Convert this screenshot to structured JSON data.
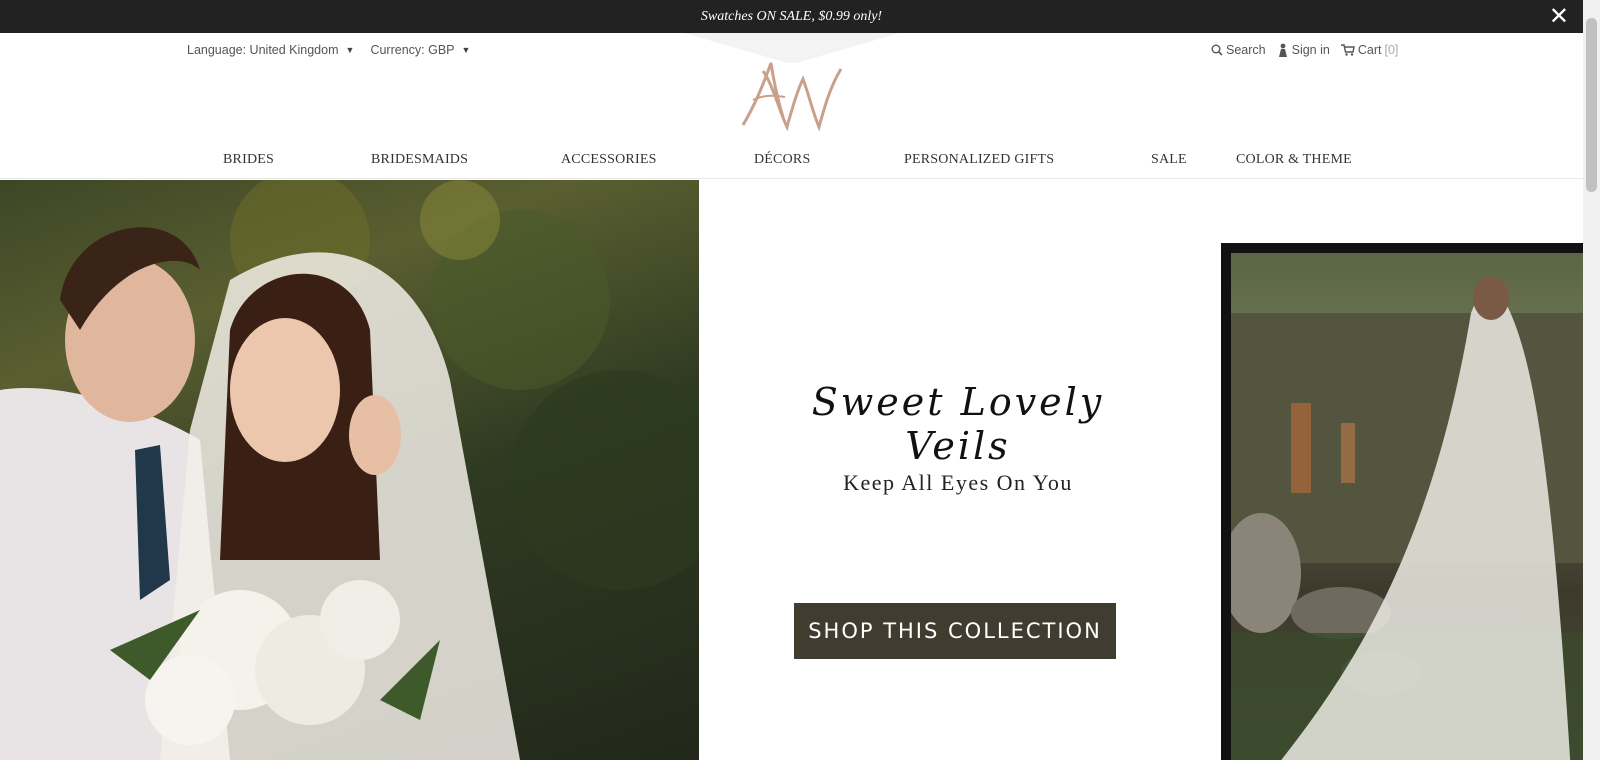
{
  "promo": {
    "text": "Swatches ON SALE, $0.99 only!",
    "close_glyph": "✕"
  },
  "utility": {
    "language_label": "Language: United Kingdom",
    "currency_label": "Currency: GBP",
    "search_label": "Search",
    "signin_label": "Sign in",
    "cart_label": "Cart",
    "cart_count": "[0]"
  },
  "logo": {
    "text": "AW",
    "color": "#c9a08a"
  },
  "nav": {
    "items": [
      {
        "label": "BRIDES"
      },
      {
        "label": "BRIDESMAIDS"
      },
      {
        "label": "ACCESSORIES"
      },
      {
        "label": "DÉCORS"
      },
      {
        "label": "PERSONALIZED GIFTS"
      },
      {
        "label": "SALE"
      },
      {
        "label": "COLOR & THEME"
      }
    ]
  },
  "hero": {
    "headline": "Sweet Lovely Veils",
    "subhead": "Keep All Eyes On You",
    "cta_label": "SHOP THIS COLLECTION",
    "cta_color": "#403c30"
  }
}
